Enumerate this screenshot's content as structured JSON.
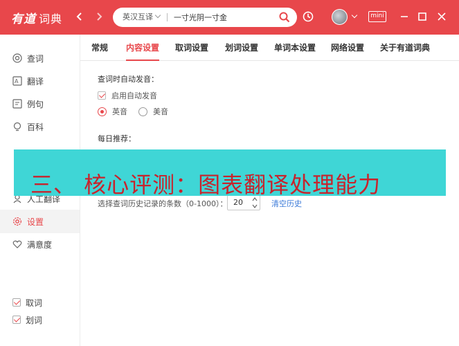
{
  "app": {
    "logo_en": "有道",
    "logo_cn": "词典",
    "brand_color": "#e8474b"
  },
  "search": {
    "lang_mode": "英汉互译",
    "value": "一寸光阴一寸金"
  },
  "toolbar": {
    "mini_label": "mini"
  },
  "sidebar": {
    "items": [
      {
        "label": "查词",
        "icon": "search-book-icon"
      },
      {
        "label": "翻译",
        "icon": "translate-icon"
      },
      {
        "label": "例句",
        "icon": "example-sentence-icon"
      },
      {
        "label": "百科",
        "icon": "lightbulb-icon"
      },
      {
        "label": "人工翻译",
        "icon": "human-translate-icon"
      },
      {
        "label": "设置",
        "icon": "gear-icon",
        "active": true
      },
      {
        "label": "满意度",
        "icon": "heart-icon"
      }
    ],
    "toggles": [
      {
        "label": "取词",
        "checked": true
      },
      {
        "label": "划词",
        "checked": true
      }
    ]
  },
  "tabs": [
    {
      "label": "常规"
    },
    {
      "label": "内容设置",
      "active": true
    },
    {
      "label": "取词设置"
    },
    {
      "label": "划词设置"
    },
    {
      "label": "单词本设置"
    },
    {
      "label": "网络设置"
    },
    {
      "label": "关于有道词典"
    }
  ],
  "content": {
    "auto_pron_title": "查词时自动发音：",
    "auto_pron_checkbox": "启用自动发音",
    "pron_options": [
      {
        "label": "英音",
        "selected": true
      },
      {
        "label": "美音",
        "selected": false
      }
    ],
    "daily_title": "每日推荐：",
    "history_label": "选择查词历史记录的条数（0-1000）：",
    "history_value": "20",
    "clear_history": "清空历史"
  },
  "overlay": {
    "text": "三、 核心评测：图表翻译处理能力",
    "bg_color": "#3fd6d6",
    "text_color": "#c8232c"
  }
}
